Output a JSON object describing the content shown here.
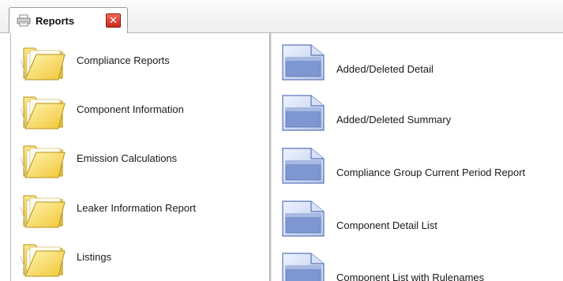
{
  "tab": {
    "title": "Reports",
    "close_glyph": "✕",
    "icon": "printer-icon",
    "close_icon": "close-icon"
  },
  "colors": {
    "folder_yellow": "#f5d64a",
    "doc_blue": "#6f8ccc",
    "close_red": "#d9342a"
  },
  "categories": [
    {
      "label": "Compliance Reports",
      "icon": "folder-icon"
    },
    {
      "label": "Component Information",
      "icon": "folder-icon"
    },
    {
      "label": "Emission Calculations",
      "icon": "folder-icon"
    },
    {
      "label": "Leaker Information Report",
      "icon": "folder-icon"
    },
    {
      "label": "Listings",
      "icon": "folder-icon"
    }
  ],
  "reports": [
    {
      "label": "Added/Deleted Detail",
      "icon": "report-document-icon"
    },
    {
      "label": "Added/Deleted Summary",
      "icon": "report-document-icon"
    },
    {
      "label": "Compliance Group Current Period Report",
      "icon": "report-document-icon"
    },
    {
      "label": "Component Detail List",
      "icon": "report-document-icon"
    },
    {
      "label": "Component List with Rulenames",
      "icon": "report-document-icon"
    }
  ]
}
